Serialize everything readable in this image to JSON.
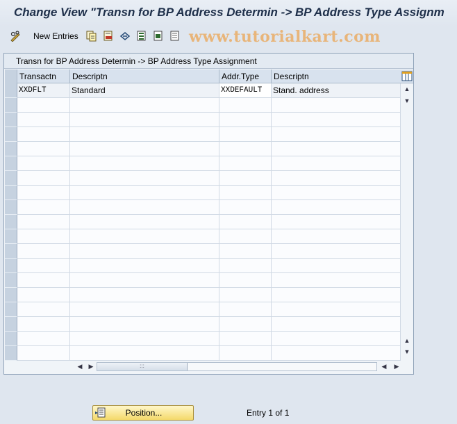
{
  "window": {
    "title": "Change View \"Transn for BP Address Determin -> BP Address Type Assignm"
  },
  "toolbar": {
    "new_entries_label": "New Entries",
    "icons": [
      "edit-glasses-icon",
      "copy-icon",
      "delete-icon",
      "undo-icon",
      "select-all-icon",
      "select-block-icon",
      "deselect-all-icon"
    ]
  },
  "watermark": "www.tutorialkart.com",
  "table": {
    "title": "Transn for BP Address Determin -> BP Address Type Assignment",
    "columns": [
      {
        "key": "transaction",
        "label": "Transactn"
      },
      {
        "key": "descr1",
        "label": "Descriptn"
      },
      {
        "key": "addr_type",
        "label": "Addr.Type"
      },
      {
        "key": "descr2",
        "label": "Descriptn"
      }
    ],
    "rows": [
      {
        "transaction": "XXDFLT",
        "descr1": "Standard",
        "addr_type": "XXDEFAULT",
        "descr2": "Stand. address"
      }
    ],
    "empty_row_count": 18
  },
  "footer": {
    "position_button_label": "Position...",
    "entry_info": "Entry 1 of 1"
  },
  "colors": {
    "background": "#dfe6ef",
    "title_text": "#1e2f4a",
    "button_gold": "#f4d96a",
    "watermark": "#e8b57a"
  }
}
